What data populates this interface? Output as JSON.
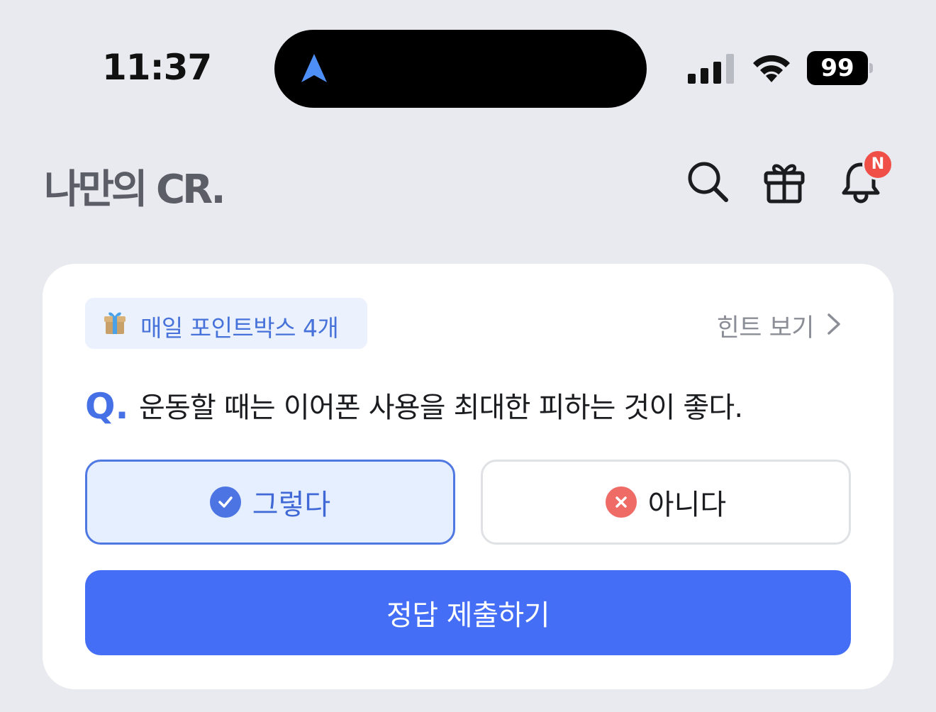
{
  "status_bar": {
    "time": "11:37",
    "battery_level": "99",
    "colors": {
      "location_arrow": "#4d8ff7"
    }
  },
  "header": {
    "logo": "나만의 CR.",
    "icons": [
      "search-icon",
      "gift-icon",
      "bell-icon"
    ],
    "notification_badge": "N"
  },
  "quiz": {
    "points_chip": "매일 포인트박스 4개",
    "hint_link": "힌트 보기",
    "question_prefix": "Q.",
    "question": "운동할 때는 이어폰 사용을 최대한 피하는 것이 좋다.",
    "answers": [
      {
        "label": "그렇다",
        "selected": true,
        "icon": "check-circle-icon"
      },
      {
        "label": "아니다",
        "selected": false,
        "icon": "x-circle-icon"
      }
    ],
    "submit_label": "정답 제출하기",
    "colors": {
      "accent": "#436ef5",
      "selected_bg": "#e6efff",
      "no_icon": "#ef6b66",
      "badge": "#ef4f47"
    }
  }
}
